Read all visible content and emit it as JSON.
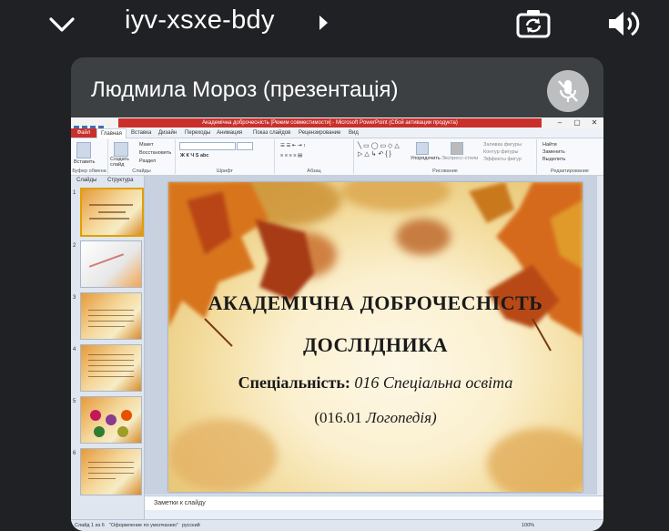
{
  "top_bar": {
    "meeting_code": "iyv-xsxe-bdy",
    "back_icon": "chevron-down-icon",
    "camera_icon": "switch-camera-icon",
    "volume_icon": "speaker-icon"
  },
  "tile": {
    "presenter_label": "Людмила Мороз (презентація)",
    "mic_icon": "mic-off-icon"
  },
  "ppt": {
    "window_title": "Академічна доброчесність [Режим совместимости] - Microsoft PowerPoint (Сбой активации продукта)",
    "file_tab": "Файл",
    "tabs": [
      "Главная",
      "Вставка",
      "Дизайн",
      "Переходы",
      "Анимация",
      "Показ слайдов",
      "Рецензирование",
      "Вид"
    ],
    "ribbon": {
      "paste": "Вставить",
      "create_slide": "Создать слайд",
      "layout": "Макет",
      "restore": "Восстановить",
      "section": "Раздел",
      "groups": [
        "Буфер обмена",
        "Слайды",
        "Шрифт",
        "Абзац",
        "Рисование",
        "Редактирование"
      ],
      "arrange": "Упорядочить",
      "quick_styles": "Экспресс-стили",
      "fill": "Заливка фигуры",
      "outline": "Контур фигуры",
      "effects": "Эффекты фигур",
      "find": "Найти",
      "replace": "Заменить",
      "select": "Выделить"
    },
    "panel_tabs": [
      "Слайды",
      "Структура"
    ],
    "thumbnails": [
      "1",
      "2",
      "3",
      "4",
      "5",
      "6"
    ],
    "slide": {
      "title_line1": "АКАДЕМІЧНА ДОБРОЧЕСНІСТЬ",
      "title_line2": "ДОСЛІДНИКА",
      "spec_label": "Спеціальність:",
      "spec_value": "016 Спеціальна освіта",
      "code_prefix": "(016.01",
      "code_value": "Логопедія)"
    },
    "notes_placeholder": "Заметки к слайду",
    "status": {
      "slide_count": "Слайд 1 из 6",
      "theme": "\"Оформление по умолчанию\"",
      "language": "русский",
      "zoom": "100%"
    }
  }
}
